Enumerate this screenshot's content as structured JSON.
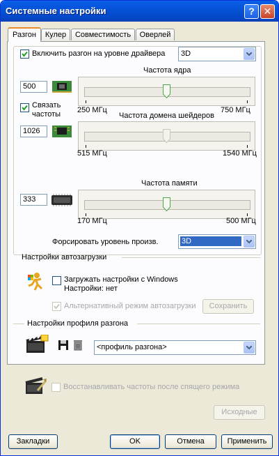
{
  "window": {
    "title": "Системные настройки",
    "help_glyph": "?",
    "close_glyph": "✕"
  },
  "tabs": [
    {
      "label": "Разгон",
      "active": true
    },
    {
      "label": "Кулер",
      "active": false
    },
    {
      "label": "Совместимость",
      "active": false
    },
    {
      "label": "Оверлей",
      "active": false
    }
  ],
  "overclock": {
    "enable_label": "Включить разгон на уровне драйвера",
    "enable_checked": true,
    "mode_value": "3D",
    "link_label_1": "Связать",
    "link_label_2": "частоты",
    "link_checked": true,
    "core": {
      "title": "Частота ядра",
      "value": "500",
      "min": "250 МГц",
      "max": "750 МГц",
      "position": 0.5
    },
    "shader": {
      "title": "Частота домена шейдеров",
      "value": "1026",
      "min": "515 МГц",
      "max": "1540 МГц",
      "position": 0.5
    },
    "memory": {
      "title": "Частота памяти",
      "value": "333",
      "min": "170 МГц",
      "max": "500 МГц",
      "position": 0.5
    },
    "force_label": "Форсировать уровень произв.",
    "force_value": "3D"
  },
  "autoload": {
    "group_title": "Настройки автозагрузки",
    "load_label": "Загружать настройки с Windows",
    "load_checked": false,
    "settings_status": "Настройки: нет",
    "alt_label": "Альтернативный режим автозагрузки",
    "alt_checked": true,
    "save_button": "Сохранить"
  },
  "profile": {
    "group_title": "Настройки профиля разгона",
    "profile_value": "<профиль разгона>"
  },
  "restore": {
    "label": "Восстанавливать частоты после спящего режима",
    "checked": false,
    "defaults_button": "Исходные"
  },
  "footer": {
    "bookmarks": "Закладки",
    "ok": "OK",
    "cancel": "Отмена",
    "apply": "Применить"
  }
}
